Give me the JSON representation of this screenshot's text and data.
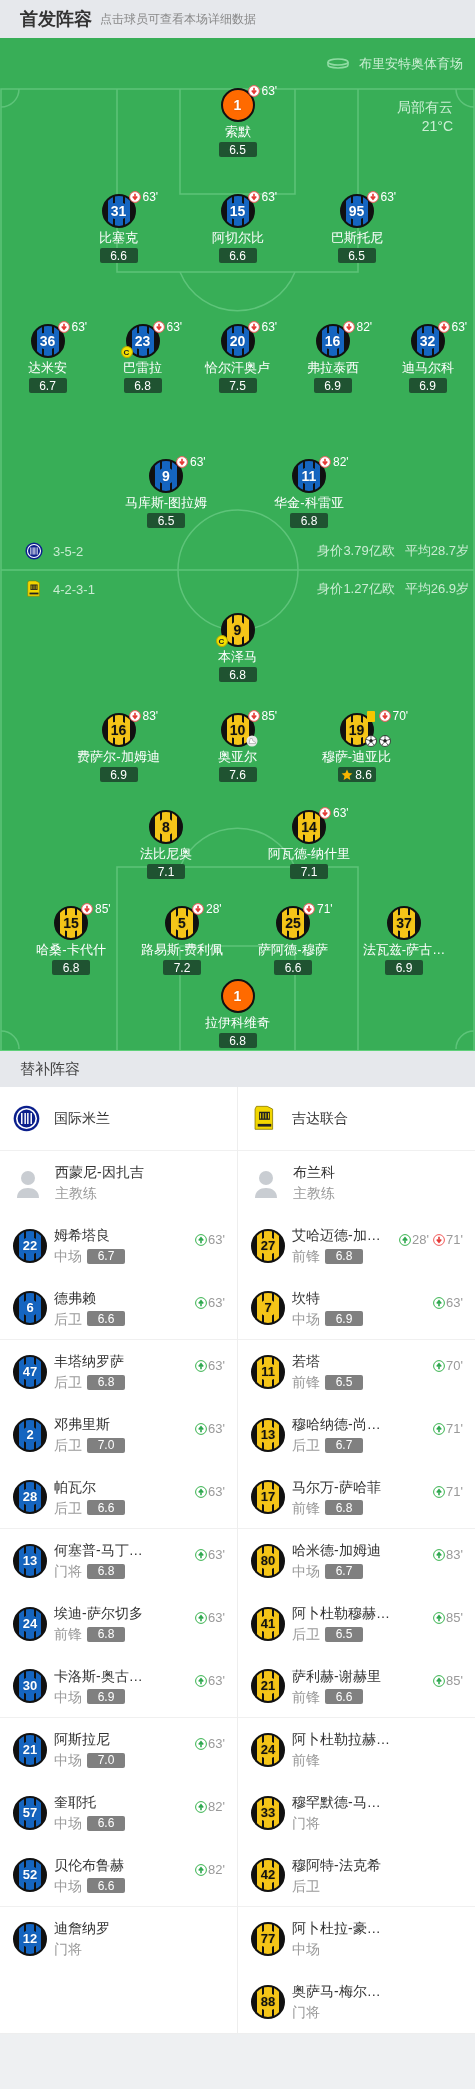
{
  "header": {
    "title": "首发阵容",
    "subtitle": "点击球员可查看本场详细数据"
  },
  "pitch": {
    "stadium": "布里安特奥体育场",
    "weather": "局部有云",
    "temperature": "21°C",
    "teams": [
      {
        "kind": "home",
        "color": "#1565c0",
        "formation": "3-5-2",
        "value": "身价3.79亿欧",
        "avg_age": "平均28.7岁",
        "lines": [
          [
            {
              "kind": "goalkeeper",
              "number": "1",
              "name": "索默",
              "rating": "6.5",
              "sub_off": "63'",
              "captain": false,
              "best": false
            }
          ],
          [
            {
              "kind": "outfield",
              "number": "31",
              "name": "比塞克",
              "rating": "6.6",
              "sub_off": "63'",
              "captain": false,
              "best": false
            },
            {
              "kind": "outfield",
              "number": "15",
              "name": "阿切尔比",
              "rating": "6.6",
              "sub_off": "63'",
              "captain": false,
              "best": false
            },
            {
              "kind": "outfield",
              "number": "95",
              "name": "巴斯托尼",
              "rating": "6.5",
              "sub_off": "63'",
              "captain": false,
              "best": false
            }
          ],
          [
            {
              "kind": "outfield",
              "number": "36",
              "name": "达米安",
              "rating": "6.7",
              "sub_off": "63'",
              "captain": false,
              "best": false
            },
            {
              "kind": "outfield",
              "number": "23",
              "name": "巴雷拉",
              "rating": "6.8",
              "sub_off": "63'",
              "captain": true,
              "captain_label": "C",
              "best": false
            },
            {
              "kind": "outfield",
              "number": "20",
              "name": "恰尔汗奥卢",
              "rating": "7.5",
              "sub_off": "63'",
              "captain": false,
              "best": false
            },
            {
              "kind": "outfield",
              "number": "16",
              "name": "弗拉泰西",
              "rating": "6.9",
              "sub_off": "82'",
              "captain": false,
              "best": false
            },
            {
              "kind": "outfield",
              "number": "32",
              "name": "迪马尔科",
              "rating": "6.9",
              "sub_off": "63'",
              "captain": false,
              "best": false
            }
          ],
          [
            {
              "kind": "outfield",
              "number": "9",
              "name": "马库斯-图拉姆",
              "rating": "6.5",
              "sub_off": "63'",
              "captain": false,
              "best": false
            },
            {
              "kind": "outfield",
              "number": "11",
              "name": "华金-科雷亚",
              "rating": "6.8",
              "sub_off": "82'",
              "captain": false,
              "best": false
            }
          ]
        ]
      },
      {
        "kind": "away",
        "color": "#f5c518",
        "formation": "4-2-3-1",
        "value": "身价1.27亿欧",
        "avg_age": "平均26.9岁",
        "lines": [
          [
            {
              "kind": "outfield",
              "number": "9",
              "name": "本泽马",
              "rating": "6.8",
              "captain": true,
              "captain_label": "C",
              "best": false
            }
          ],
          [
            {
              "kind": "outfield",
              "number": "16",
              "name": "费萨尔-加姆迪",
              "rating": "6.9",
              "sub_off": "83'",
              "captain": false,
              "best": false
            },
            {
              "kind": "outfield",
              "number": "10",
              "name": "奥亚尔",
              "rating": "7.6",
              "sub_off": "85'",
              "captain": false,
              "best": false,
              "events": [
                {
                  "kind": "assist"
                }
              ]
            },
            {
              "kind": "outfield",
              "number": "19",
              "name": "穆萨-迪亚比",
              "rating": "8.6",
              "sub_off": "70'",
              "captain": false,
              "best": true,
              "events": [
                {
                  "kind": "yellow_card"
                },
                {
                  "kind": "goal"
                },
                {
                  "kind": "goal"
                }
              ]
            }
          ],
          [
            {
              "kind": "outfield",
              "number": "8",
              "name": "法比尼奥",
              "rating": "7.1",
              "captain": false,
              "best": false
            },
            {
              "kind": "outfield",
              "number": "14",
              "name": "阿瓦德-纳什里",
              "rating": "7.1",
              "sub_off": "63'",
              "captain": false,
              "best": false
            }
          ],
          [
            {
              "kind": "outfield",
              "number": "15",
              "name": "哈桑-卡代什",
              "rating": "6.8",
              "sub_off": "85'",
              "captain": false,
              "best": false
            },
            {
              "kind": "outfield",
              "number": "5",
              "name": "路易斯-费利佩",
              "rating": "7.2",
              "sub_off": "28'",
              "captain": false,
              "best": false
            },
            {
              "kind": "outfield",
              "number": "25",
              "name": "萨阿德-穆萨",
              "rating": "6.6",
              "sub_off": "71'",
              "captain": false,
              "best": false
            },
            {
              "kind": "outfield",
              "number": "37",
              "name": "法瓦兹-萨古…",
              "rating": "6.9",
              "captain": false,
              "best": false
            }
          ],
          [
            {
              "kind": "goalkeeper",
              "number": "1",
              "name": "拉伊科维奇",
              "rating": "6.8",
              "captain": false,
              "best": false
            }
          ]
        ]
      }
    ]
  },
  "substitutes": {
    "title": "替补阵容",
    "teams": [
      {
        "kind": "home",
        "name": "国际米兰",
        "color": "#1565c0",
        "coach": {
          "name": "西蒙尼-因扎吉",
          "role": "主教练"
        },
        "players": [
          {
            "number": "22",
            "name": "姆希塔良",
            "position": "中场",
            "rating": "6.7",
            "sub_in": "63'"
          },
          {
            "number": "6",
            "name": "德弗赖",
            "position": "后卫",
            "rating": "6.6",
            "sub_in": "63'"
          },
          {
            "number": "47",
            "name": "丰塔纳罗萨",
            "position": "后卫",
            "rating": "6.8",
            "sub_in": "63'"
          },
          {
            "number": "2",
            "name": "邓弗里斯",
            "position": "后卫",
            "rating": "7.0",
            "sub_in": "63'"
          },
          {
            "number": "28",
            "name": "帕瓦尔",
            "position": "后卫",
            "rating": "6.6",
            "sub_in": "63'"
          },
          {
            "number": "13",
            "name": "何塞普-马丁…",
            "position": "门将",
            "rating": "6.8",
            "sub_in": "63'"
          },
          {
            "number": "24",
            "name": "埃迪-萨尔切多",
            "position": "前锋",
            "rating": "6.8",
            "sub_in": "63'"
          },
          {
            "number": "30",
            "name": "卡洛斯-奥古…",
            "position": "中场",
            "rating": "6.9",
            "sub_in": "63'"
          },
          {
            "number": "21",
            "name": "阿斯拉尼",
            "position": "中场",
            "rating": "7.0",
            "sub_in": "63'"
          },
          {
            "number": "57",
            "name": "奎耶托",
            "position": "中场",
            "rating": "6.6",
            "sub_in": "82'"
          },
          {
            "number": "52",
            "name": "贝伦布鲁赫",
            "position": "中场",
            "rating": "6.6",
            "sub_in": "82'"
          },
          {
            "number": "12",
            "name": "迪詹纳罗",
            "position": "门将"
          }
        ]
      },
      {
        "kind": "away",
        "name": "吉达联合",
        "color": "#f5c518",
        "coach": {
          "name": "布兰科",
          "role": "主教练"
        },
        "players": [
          {
            "number": "27",
            "name": "艾哈迈德-加…",
            "position": "前锋",
            "rating": "6.8",
            "sub_in": "28'",
            "sub_off": "71'"
          },
          {
            "number": "7",
            "name": "坎特",
            "position": "中场",
            "rating": "6.9",
            "sub_in": "63'"
          },
          {
            "number": "11",
            "name": "若塔",
            "position": "前锋",
            "rating": "6.5",
            "sub_in": "70'"
          },
          {
            "number": "13",
            "name": "穆哈纳德-尚…",
            "position": "后卫",
            "rating": "6.7",
            "sub_in": "71'"
          },
          {
            "number": "17",
            "name": "马尔万-萨哈菲",
            "position": "前锋",
            "rating": "6.8",
            "sub_in": "71'"
          },
          {
            "number": "80",
            "name": "哈米德-加姆迪",
            "position": "中场",
            "rating": "6.7",
            "sub_in": "83'"
          },
          {
            "number": "41",
            "name": "阿卜杜勒穆赫…",
            "position": "后卫",
            "rating": "6.5",
            "sub_in": "85'"
          },
          {
            "number": "21",
            "name": "萨利赫-谢赫里",
            "position": "前锋",
            "rating": "6.6",
            "sub_in": "85'"
          },
          {
            "number": "24",
            "name": "阿卜杜勒拉赫…",
            "position": "前锋"
          },
          {
            "number": "33",
            "name": "穆罕默德-马…",
            "position": "门将"
          },
          {
            "number": "42",
            "name": "穆阿特-法克希",
            "position": "后卫"
          },
          {
            "number": "77",
            "name": "阿卜杜拉-豪…",
            "position": "中场"
          },
          {
            "number": "88",
            "name": "奥萨马-梅尔…",
            "position": "门将"
          }
        ]
      }
    ]
  }
}
